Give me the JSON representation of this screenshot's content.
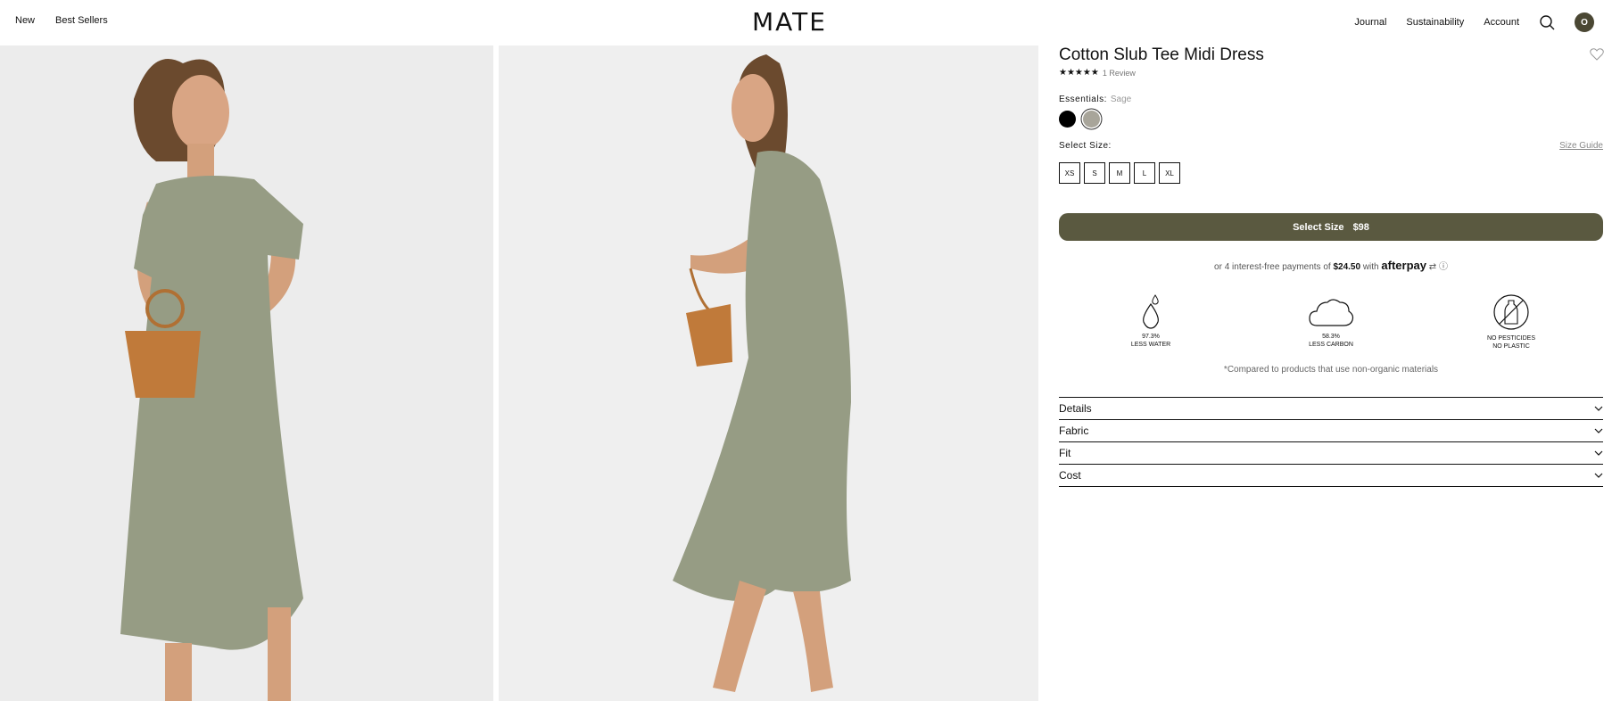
{
  "header": {
    "nav_left": [
      "New",
      "Best Sellers"
    ],
    "logo": "MATE",
    "nav_right": [
      "Journal",
      "Sustainability",
      "Account"
    ],
    "avatar_initial": "O"
  },
  "product": {
    "title": "Cotton Slub Tee Midi Dress",
    "rating": 5,
    "review_text": "1 Review",
    "colour_label": "Essentials:",
    "colour_name": "Sage",
    "swatches": [
      {
        "name": "Black",
        "color": "#000000"
      },
      {
        "name": "Sage",
        "color": "#a8a59a"
      }
    ],
    "size_label": "Select Size:",
    "size_guide": "Size Guide",
    "sizes": [
      "XS",
      "S",
      "M",
      "L",
      "XL"
    ],
    "cta_label": "Select Size",
    "price": "$98",
    "afterpay_prefix": "or 4 interest-free payments of",
    "afterpay_amount": "$24.50",
    "afterpay_with": "with",
    "afterpay_brand": "afterpay",
    "stats": [
      {
        "value": "97.3%",
        "label": "LESS WATER",
        "icon": "water-drop-icon"
      },
      {
        "value": "58.3%",
        "label": "LESS CARBON",
        "icon": "cloud-icon"
      },
      {
        "value": "NO PESTICIDES",
        "label": "NO PLASTIC",
        "icon": "no-plastic-bottle-icon"
      }
    ],
    "footnote": "*Compared to products that use non-organic materials",
    "accordion": [
      "Details",
      "Fabric",
      "Fit",
      "Cost"
    ]
  },
  "colors": {
    "accent": "#5a5940",
    "background": "#ffffff",
    "photo_bg": "#eeeeee",
    "dress": "#969c84"
  }
}
